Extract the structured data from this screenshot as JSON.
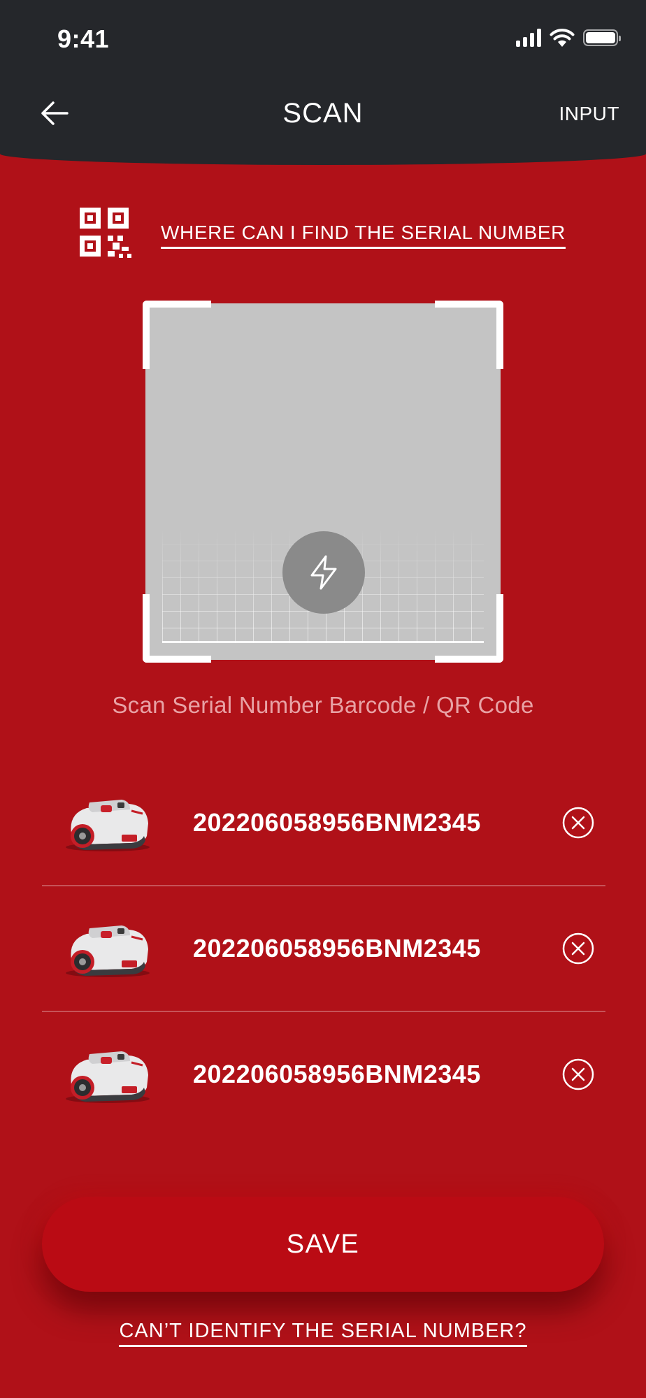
{
  "status_bar": {
    "time": "9:41",
    "icons": [
      "cellular-signal-icon",
      "wifi-icon",
      "battery-icon"
    ]
  },
  "nav": {
    "back_icon": "arrow-left-icon",
    "title": "SCAN",
    "action": "INPUT"
  },
  "help": {
    "icon": "qr-code-icon",
    "link": "WHERE CAN I FIND THE SERIAL NUMBER"
  },
  "scanner": {
    "flash_icon": "lightning-bolt-icon",
    "hint": "Scan Serial Number Barcode / QR Code"
  },
  "devices": [
    {
      "serial": "202206058956BNM2345",
      "image": "robot-lawn-mower",
      "remove_icon": "circle-x-icon"
    },
    {
      "serial": "202206058956BNM2345",
      "image": "robot-lawn-mower",
      "remove_icon": "circle-x-icon"
    },
    {
      "serial": "202206058956BNM2345",
      "image": "robot-lawn-mower",
      "remove_icon": "circle-x-icon"
    }
  ],
  "save_label": "SAVE",
  "footer_link": "CAN’T IDENTIFY THE SERIAL NUMBER?",
  "colors": {
    "header_bg": "#25272b",
    "page_bg": "#b01118",
    "save_button": "#ba0b14",
    "viewfinder": "#c4c4c4",
    "hint_text": "#e8a2a5"
  }
}
